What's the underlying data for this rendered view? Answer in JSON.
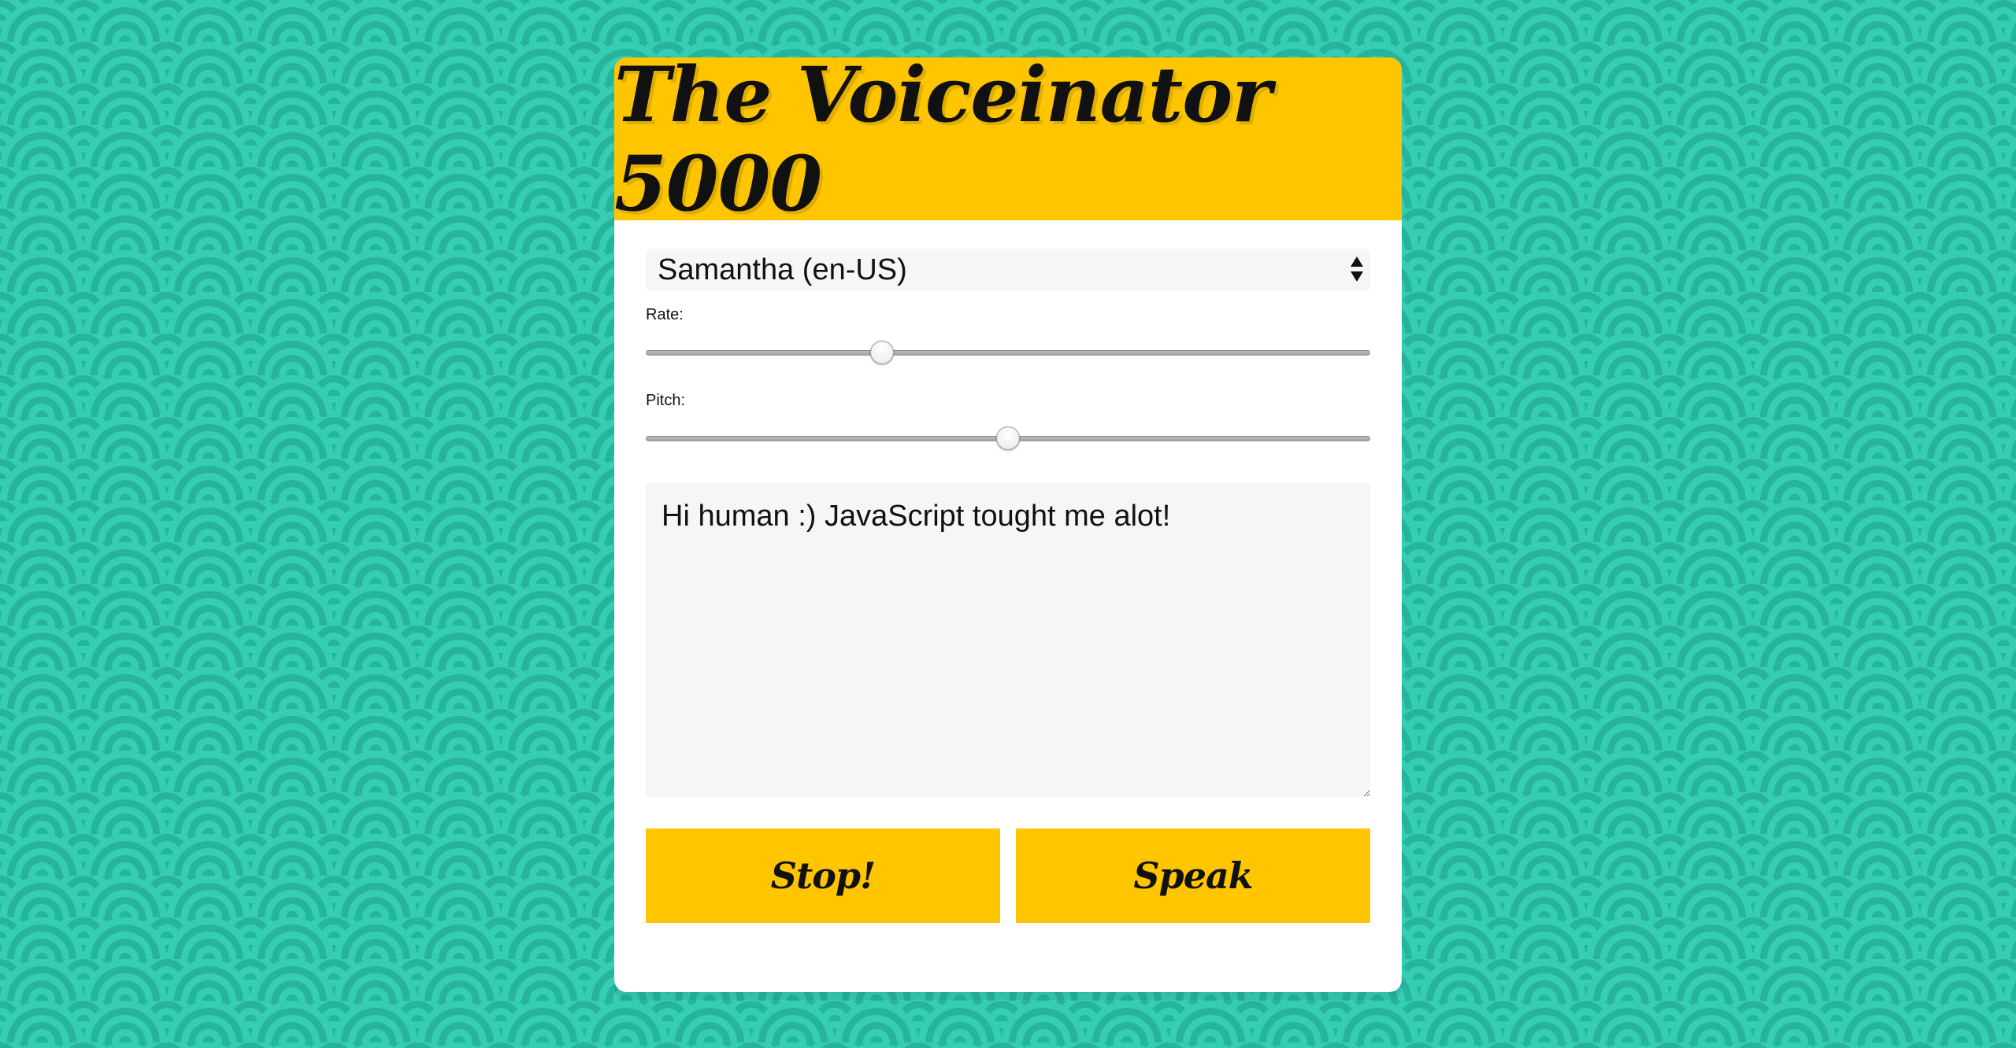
{
  "title": "The Voiceinator 5000",
  "voice_select": {
    "selected": "Samantha (en-US)"
  },
  "rate": {
    "label": "Rate:",
    "value_fraction": 0.32
  },
  "pitch": {
    "label": "Pitch:",
    "value_fraction": 0.5
  },
  "message": {
    "value": "Hi human :) JavaScript tought me alot!"
  },
  "buttons": {
    "stop_label": "Stop!",
    "speak_label": "Speak"
  },
  "colors": {
    "accent": "#ffc600",
    "background": "#2fc6ad",
    "panel": "#ffffff"
  },
  "icons": {
    "select_arrows": "up-down-arrows-icon"
  }
}
